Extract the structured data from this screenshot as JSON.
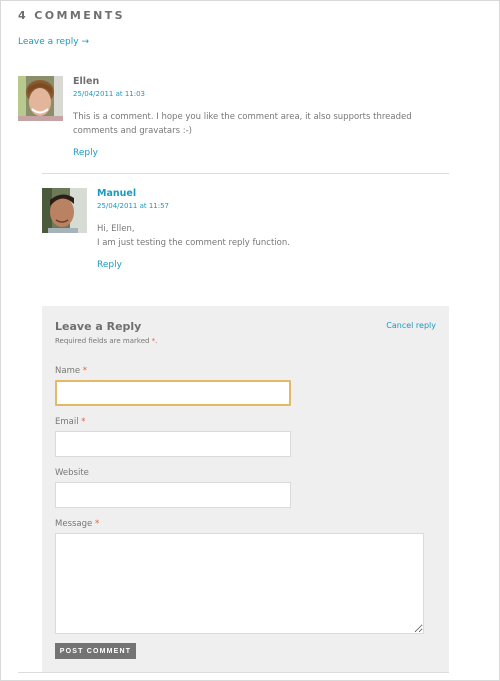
{
  "comments_section": {
    "title": "4 COMMENTS",
    "leave_reply_link": "Leave a reply →"
  },
  "comments": [
    {
      "author": "Ellen",
      "date": "25/04/2011 at 11:03",
      "body_lines": [
        "This is a comment. I hope you like the comment area, it also supports threaded",
        "comments and gravatars :-)"
      ],
      "reply_label": "Reply",
      "avatar": "avatar-ellen",
      "author_is_link": false
    },
    {
      "author": "Manuel",
      "date": "25/04/2011 at 11:57",
      "body_lines": [
        "Hi, Ellen,",
        "I am just testing the comment reply function."
      ],
      "reply_label": "Reply",
      "avatar": "avatar-manuel",
      "author_is_link": true
    }
  ],
  "reply_form": {
    "title": "Leave a Reply",
    "cancel_label": "Cancel reply",
    "required_note_prefix": "Required fields are marked ",
    "required_marker": "*",
    "required_note_suffix": ".",
    "fields": [
      {
        "label": "Name",
        "required": true,
        "value": "",
        "focused": true
      },
      {
        "label": "Email",
        "required": true,
        "value": ""
      },
      {
        "label": "Website",
        "required": false,
        "value": ""
      },
      {
        "label": "Message",
        "required": true,
        "value": ""
      }
    ],
    "submit_label": "POST COMMENT"
  },
  "colors": {
    "link": "#1a9ac0",
    "heading": "#6f6f6f",
    "required": "#e0603c",
    "focus_border": "#e3b866",
    "form_bg": "#efefef",
    "button_bg": "#737373"
  }
}
